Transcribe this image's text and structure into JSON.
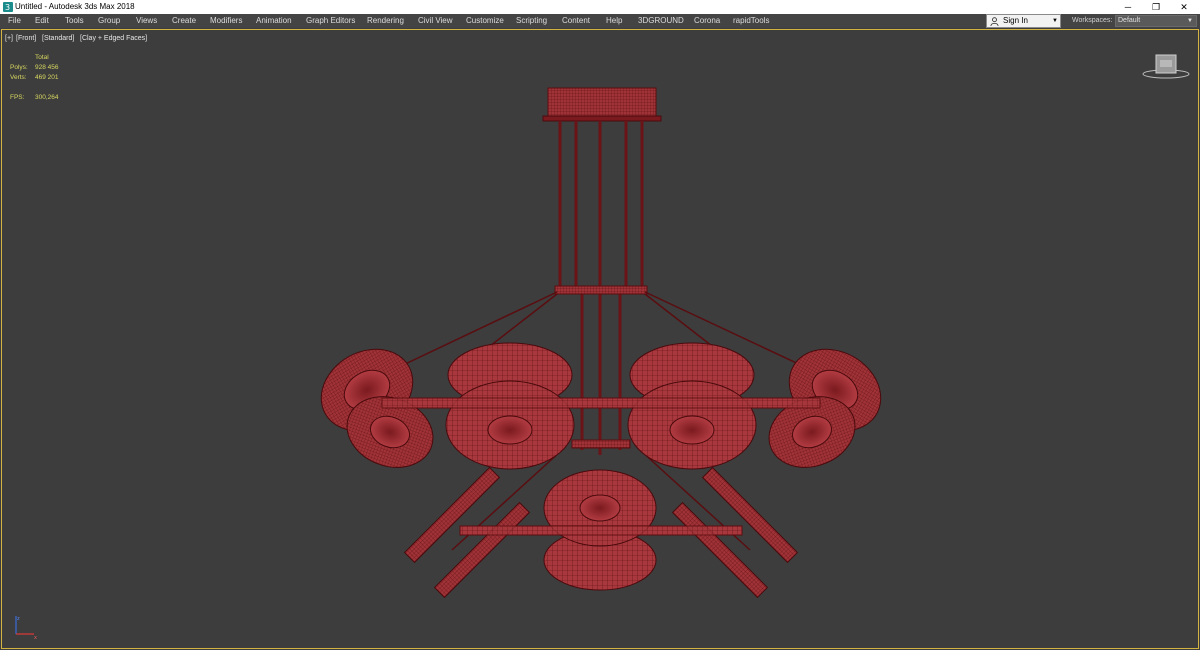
{
  "window": {
    "title": "Untitled - Autodesk 3ds Max 2018",
    "minimize": "─",
    "maximize": "❐",
    "close": "✕"
  },
  "menu": [
    "File",
    "Edit",
    "Tools",
    "Group",
    "Views",
    "Create",
    "Modifiers",
    "Animation",
    "Graph Editors",
    "Rendering",
    "Civil View",
    "Customize",
    "Scripting",
    "Content",
    "Help",
    "3DGROUND",
    "Corona",
    "rapidTools"
  ],
  "signin": {
    "label": "Sign In"
  },
  "workspaces": {
    "label": "Workspaces:",
    "value": "Default"
  },
  "viewport": {
    "labels": [
      "[+]",
      "[Front]",
      "[Standard]",
      "[Clay + Edged Faces]"
    ],
    "stats": {
      "header": "Total",
      "polys_label": "Polys:",
      "polys_value": "928 456",
      "verts_label": "Verts:",
      "verts_value": "469 201",
      "fps_label": "FPS:",
      "fps_value": "300,264"
    }
  },
  "colors": {
    "viewport_bg": "#3d3d3d",
    "mesh_fill": "#a8383d",
    "wire": "#5a0d10",
    "active_border": "#d4b440",
    "stats_text": "#d8d860"
  }
}
